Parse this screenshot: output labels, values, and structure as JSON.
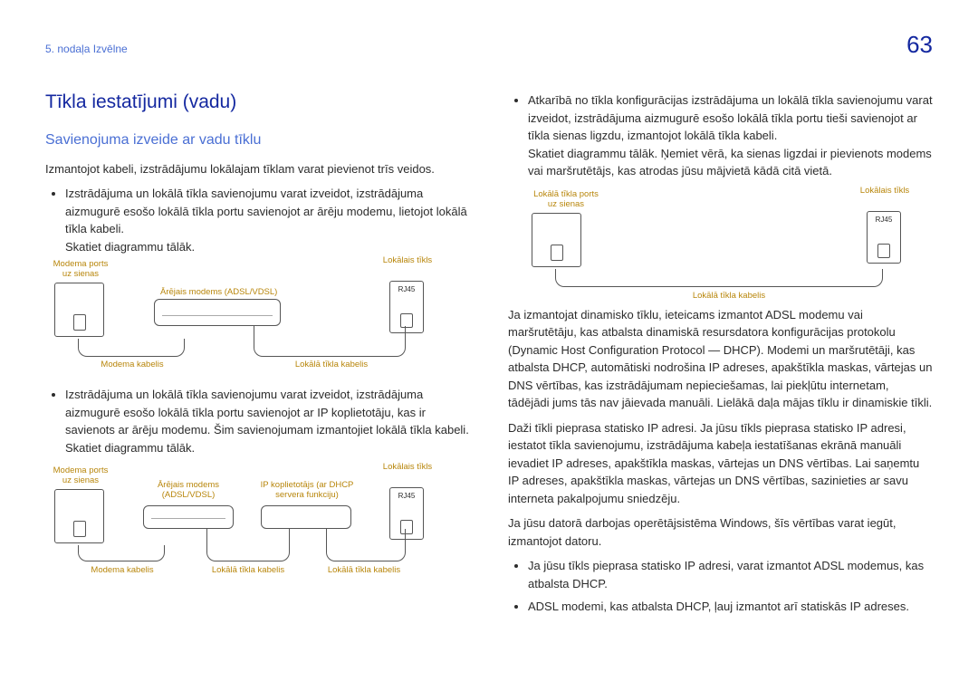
{
  "chapter": "5. nodaļa Izvēlne",
  "page_number": "63",
  "h1": "Tīkla iestatījumi (vadu)",
  "h2": "Savienojuma izveide ar vadu tīklu",
  "left": {
    "intro": "Izmantojot kabeli, izstrādājumu lokālajam tīklam varat pievienot trīs veidos.",
    "b1_text": "Izstrādājuma un lokālā tīkla savienojumu varat izveidot, izstrādājuma aizmugurē esošo lokālā tīkla portu savienojot ar ārēju modemu, lietojot lokālā tīkla kabeli.",
    "b1_see": "Skatiet diagrammu tālāk.",
    "b2_text": "Izstrādājuma un lokālā tīkla savienojumu varat izveidot, izstrādājuma aizmugurē esošo lokālā tīkla portu savienojot ar IP koplietotāju, kas ir savienots ar ārēju modemu. Šim savienojumam izmantojiet lokālā tīkla kabeli.",
    "b2_see": "Skatiet diagrammu tālāk."
  },
  "labels": {
    "wall_port": "Modema ports\nuz sienas",
    "external_modem": "Ārējais modems (ADSL/VDSL)",
    "external_modem_short": "Ārējais modems\n(ADSL/VDSL)",
    "ip_sharer": "IP koplietotājs (ar DHCP\nservera funkciju)",
    "lan_title": "Lokālais tīkls",
    "modem_cable": "Modema kabelis",
    "lan_cable": "Lokālā tīkla kabelis",
    "lan_port_wall": "Lokālā tīkla ports\nuz sienas",
    "rj45": "RJ45"
  },
  "right": {
    "b3_text": "Atkarībā no tīkla konfigurācijas izstrādājuma un lokālā tīkla savienojumu varat izveidot, izstrādājuma aizmugurē esošo lokālā tīkla portu tieši savienojot ar tīkla sienas ligzdu, izmantojot lokālā tīkla kabeli.",
    "b3_see": "Skatiet diagrammu tālāk. Ņemiet vērā, ka sienas ligzdai ir pievienots modems vai maršrutētājs, kas atrodas jūsu mājvietā kādā citā vietā.",
    "p1": "Ja izmantojat dinamisko tīklu, ieteicams izmantot ADSL modemu vai maršrutētāju, kas atbalsta dinamiskā resursdatora konfigurācijas protokolu (Dynamic Host Configuration Protocol — DHCP). Modemi un maršrutētāji, kas atbalsta DHCP, automātiski nodrošina IP adreses, apakštīkla maskas, vārtejas un DNS vērtības, kas izstrādājumam nepieciešamas, lai piekļūtu internetam, tādējādi jums tās nav jāievada manuāli. Lielākā daļa mājas tīklu ir dinamiskie tīkli.",
    "p2": "Daži tīkli pieprasa statisko IP adresi. Ja jūsu tīkls pieprasa statisko IP adresi, iestatot tīkla savienojumu, izstrādājuma kabeļa iestatīšanas ekrānā manuāli ievadiet IP adreses, apakštīkla maskas, vārtejas un DNS vērtības. Lai saņemtu IP adreses, apakštīkla maskas, vārtejas un DNS vērtības, sazinieties ar savu interneta pakalpojumu sniedzēju.",
    "p3": "Ja jūsu datorā darbojas operētājsistēma Windows, šīs vērtības varat iegūt, izmantojot datoru.",
    "sub1": "Ja jūsu tīkls pieprasa statisko IP adresi, varat izmantot ADSL modemus, kas atbalsta DHCP.",
    "sub2": "ADSL modemi, kas atbalsta DHCP, ļauj izmantot arī statiskās IP adreses."
  }
}
